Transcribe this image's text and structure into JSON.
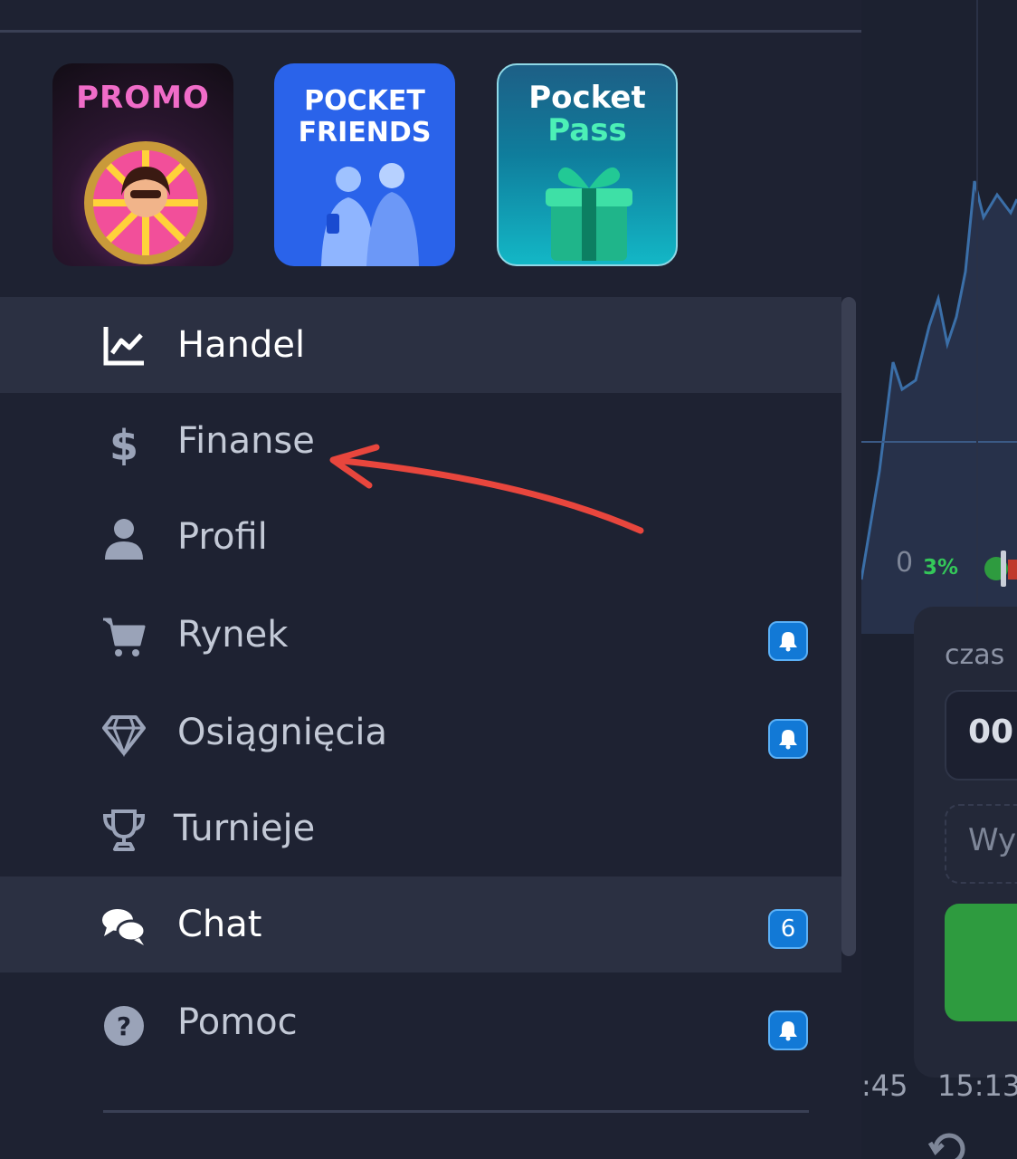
{
  "promos": [
    {
      "title": "PROMO"
    },
    {
      "title_line1": "POCKET",
      "title_line2": "FRIENDS"
    },
    {
      "title_line1": "Pocket",
      "title_line2": "Pass"
    }
  ],
  "menu": [
    {
      "label": "Handel",
      "icon": "chart-line-icon",
      "active": true
    },
    {
      "label": "Finanse",
      "icon": "dollar-icon"
    },
    {
      "label": "Profil",
      "icon": "user-icon"
    },
    {
      "label": "Rynek",
      "icon": "cart-icon",
      "badge_icon": "bell-icon"
    },
    {
      "label": "Osiągnięcia",
      "icon": "diamond-icon",
      "badge_icon": "bell-icon"
    },
    {
      "label": "Turnieje",
      "icon": "trophy-icon"
    },
    {
      "label": "Chat",
      "icon": "chat-icon",
      "active": true,
      "badge": "6"
    },
    {
      "label": "Pomoc",
      "icon": "help-icon",
      "badge_icon": "bell-icon"
    }
  ],
  "background": {
    "zero": "0",
    "percent": "3%",
    "time_label": "czas",
    "time_value": "00:",
    "payout_label": "Wy",
    "time_ticks": [
      ":45",
      "15:13"
    ]
  },
  "colors": {
    "sidebar_bg": "#1e2232",
    "active_row": "#2b3042",
    "badge": "#1279d6",
    "arrow": "#e8463d",
    "green": "#2e9b3f"
  }
}
